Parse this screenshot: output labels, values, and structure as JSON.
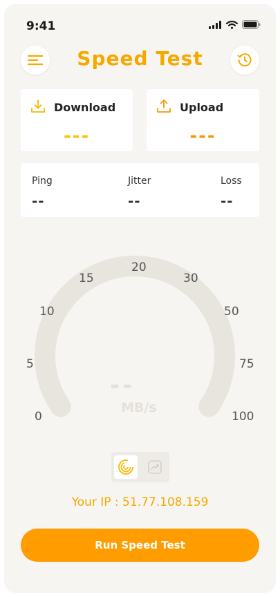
{
  "status_bar": {
    "time": "9:41"
  },
  "header": {
    "title": "Speed Test"
  },
  "cards": {
    "download": {
      "label": "Download",
      "value": "---"
    },
    "upload": {
      "label": "Upload",
      "value": "---"
    }
  },
  "stats": {
    "ping": {
      "label": "Ping",
      "value": "--"
    },
    "jitter": {
      "label": "Jitter",
      "value": "--"
    },
    "loss": {
      "label": "Loss",
      "value": "--"
    }
  },
  "gauge": {
    "ticks": [
      "0",
      "5",
      "10",
      "15",
      "20",
      "30",
      "50",
      "75",
      "100"
    ],
    "value": "--",
    "unit": "MB/s",
    "level": 0
  },
  "ip_text": "Your IP : 51.77.108.159",
  "run_button": "Run Speed Test",
  "colors": {
    "accent": "#f5a800",
    "download": "#f7c400",
    "upload": "#f29a00",
    "button": "#ff9d00",
    "gauge_track": "#e8e4de"
  },
  "icons": {
    "menu": "menu-icon",
    "history": "history-icon",
    "download": "download-icon",
    "upload": "upload-icon",
    "gauge_mode": "gauge-mode-icon",
    "graph_mode": "graph-mode-icon"
  }
}
